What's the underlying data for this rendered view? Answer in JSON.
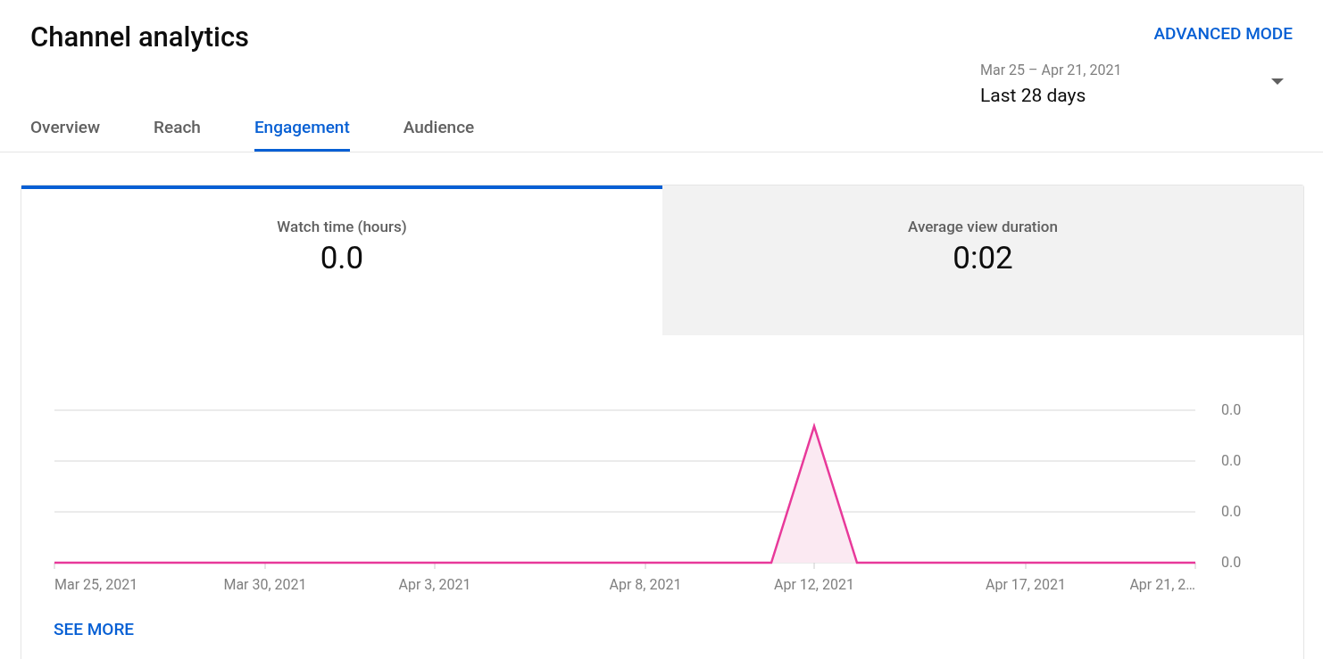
{
  "page_title": "Channel analytics",
  "advanced_mode_link": "ADVANCED MODE",
  "tabs": [
    {
      "label": "Overview",
      "selected": false
    },
    {
      "label": "Reach",
      "selected": false
    },
    {
      "label": "Engagement",
      "selected": true
    },
    {
      "label": "Audience",
      "selected": false
    }
  ],
  "date_range": {
    "range": "Mar 25 – Apr 21, 2021",
    "value": "Last 28 days"
  },
  "metrics": [
    {
      "label": "Watch time (hours)",
      "value": "0.0",
      "selected": true
    },
    {
      "label": "Average view duration",
      "value": "0:02",
      "selected": false
    }
  ],
  "chart": {
    "y_axis_labels": [
      "0.0",
      "0.0",
      "0.0",
      "0.0"
    ],
    "x_axis_labels": [
      "Mar 25, 2021",
      "Mar 30, 2021",
      "Apr 3, 2021",
      "Apr 8, 2021",
      "Apr 12, 2021",
      "Apr 17, 2021",
      "Apr 21, 2…"
    ]
  },
  "see_more_link": "SEE MORE"
}
